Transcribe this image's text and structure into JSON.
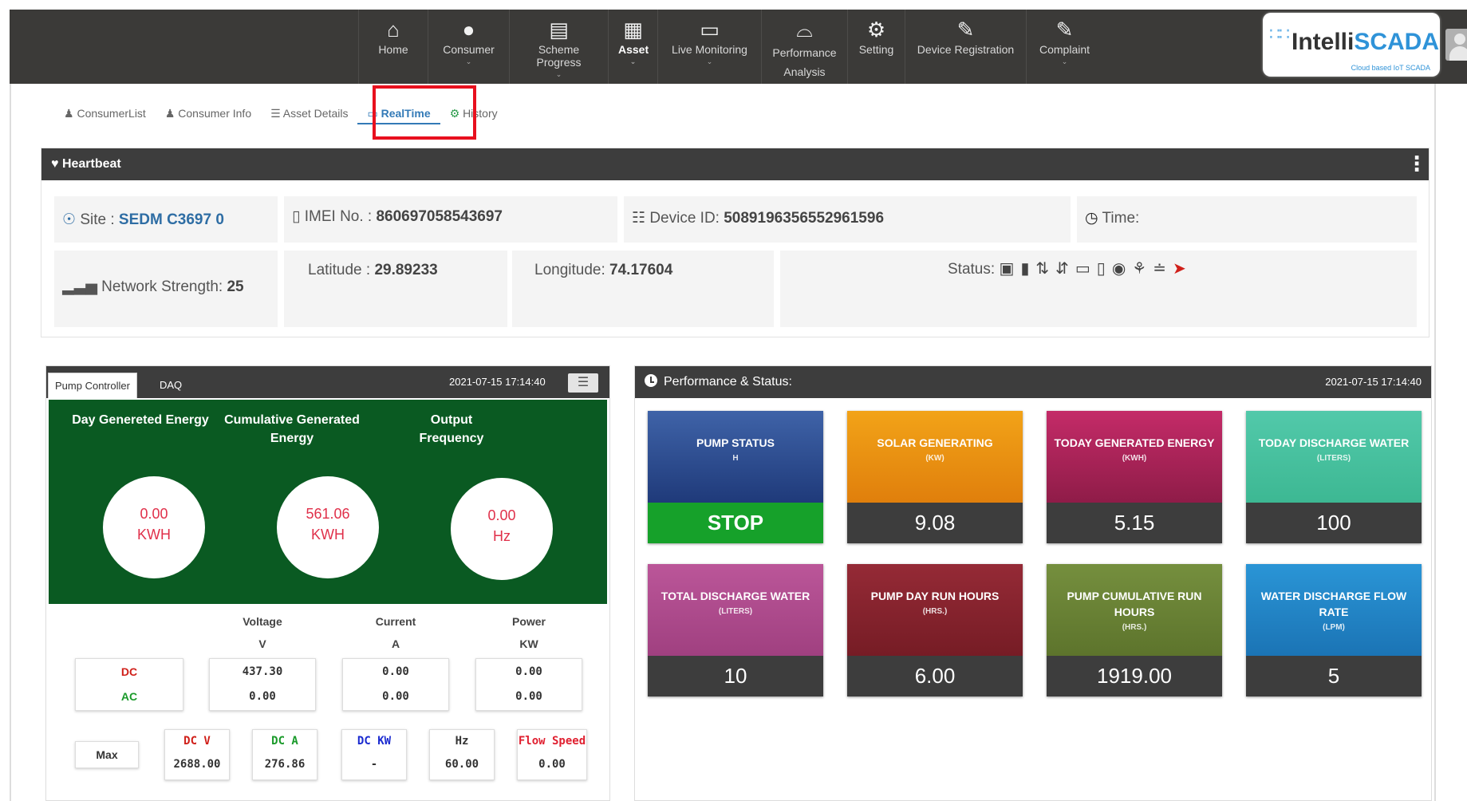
{
  "topnav": {
    "items": [
      {
        "label": "Home",
        "icon": "home-icon"
      },
      {
        "label": "Consumer",
        "icon": "user-icon"
      },
      {
        "label": "Scheme Progress",
        "icon": "list-icon"
      },
      {
        "label": "Asset",
        "icon": "grid-icon"
      },
      {
        "label": "Live Monitoring",
        "icon": "monitor-icon"
      },
      {
        "label": "Performance Analysis",
        "icon": "chart-icon"
      },
      {
        "label": "Setting",
        "icon": "gear-icon"
      },
      {
        "label": "Device Registration",
        "icon": "edit-icon"
      },
      {
        "label": "Complaint",
        "icon": "edit-icon"
      }
    ],
    "active": "Asset"
  },
  "brand": {
    "name_prefix": "Intelli",
    "name_suffix": "SCADA",
    "tagline": "Cloud based IoT SCADA"
  },
  "subtabs": [
    {
      "label": "ConsumerList",
      "icon": "user-icon"
    },
    {
      "label": "Consumer Info",
      "icon": "user-icon"
    },
    {
      "label": "Asset Details",
      "icon": "list-icon"
    },
    {
      "label": "RealTime",
      "icon": "monitor-icon"
    },
    {
      "label": "History",
      "icon": "gear-icon"
    }
  ],
  "heartbeat": {
    "title": "Heartbeat",
    "site_label": "Site :",
    "site_value": "SEDM C3697 0",
    "imei_label": "IMEI No. :",
    "imei_value": "860697058543697",
    "device_label": "Device ID:",
    "device_value": "5089196356552961596",
    "time_label": "Time:",
    "network_label": "Network Strength:",
    "network_value": "25",
    "lat_label": "Latitude  :",
    "lat_value": "29.89233",
    "lon_label": "Longitude:",
    "lon_value": "74.17604",
    "status_label": "Status:"
  },
  "pump_controller": {
    "tabs": [
      "Pump Controller",
      "DAQ"
    ],
    "timestamp": "2021-07-15 17:14:40",
    "gauges": [
      {
        "title": "Day Genereted Energy",
        "value": "0.00",
        "unit": "KWH"
      },
      {
        "title": "Cumulative Generated Energy",
        "value": "561.06",
        "unit": "KWH"
      },
      {
        "title": "Output Frequency",
        "value": "0.00",
        "unit": "Hz"
      }
    ],
    "columns": [
      {
        "name": "Voltage",
        "unit": "V",
        "dc": "437.30",
        "ac": "0.00"
      },
      {
        "name": "Current",
        "unit": "A",
        "dc": "0.00",
        "ac": "0.00"
      },
      {
        "name": "Power",
        "unit": "KW",
        "dc": "0.00",
        "ac": "0.00"
      }
    ],
    "row_labels": {
      "dc": "DC",
      "ac": "AC"
    },
    "max_label": "Max",
    "max_values": [
      {
        "label": "DC V",
        "value": "2688.00",
        "color": "#d0201a"
      },
      {
        "label": "DC A",
        "value": "276.86",
        "color": "#1a9a2a"
      },
      {
        "label": "DC KW",
        "value": "-",
        "color": "#1a2ad0"
      },
      {
        "label": "Hz",
        "value": "60.00",
        "color": "#333333"
      },
      {
        "label": "Flow Speed",
        "value": "0.00",
        "color": "#e02030"
      }
    ]
  },
  "performance": {
    "title": "Performance & Status:",
    "timestamp": "2021-07-15 17:14:40",
    "tiles": [
      {
        "label": "Pump Status",
        "unit": "H",
        "value": "STOP",
        "color": "#3f63a8"
      },
      {
        "label": "Solar Generating",
        "unit": "(KW)",
        "value": "9.08",
        "color": "#ef9412"
      },
      {
        "label": "Today Generated Energy",
        "unit": "(KWH)",
        "value": "5.15",
        "color": "#b7245e"
      },
      {
        "label": "Today Discharge Water",
        "unit": "(Liters)",
        "value": "100",
        "color": "#4cc4a6"
      },
      {
        "label": "Total Discharge Water",
        "unit": "(Liters)",
        "value": "10",
        "color": "#b24d90"
      },
      {
        "label": "Pump Day Run Hours",
        "unit": "(Hrs.)",
        "value": "6.00",
        "color": "#8a2530"
      },
      {
        "label": "Pump Cumulative Run Hours",
        "unit": "(Hrs.)",
        "value": "1919.00",
        "color": "#6c8538"
      },
      {
        "label": "Water Discharge Flow Rate",
        "unit": "(LPM)",
        "value": "5",
        "color": "#2287c9"
      }
    ],
    "stop_color": "#16a12a"
  }
}
